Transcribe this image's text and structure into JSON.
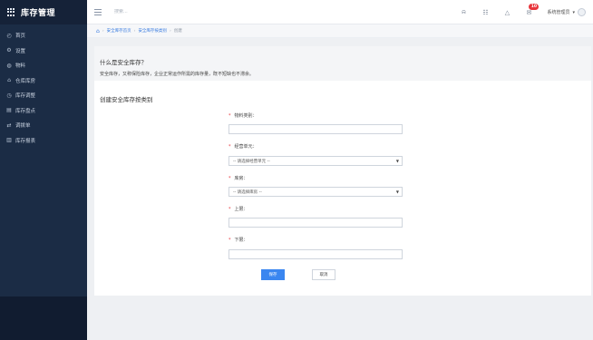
{
  "app": {
    "title": "库存管理"
  },
  "sidebar": {
    "items": [
      {
        "label": "首页",
        "icon": "dashboard-icon"
      },
      {
        "label": "设置",
        "icon": "settings-icon"
      },
      {
        "label": "物料",
        "icon": "material-icon"
      },
      {
        "label": "仓库库房",
        "icon": "warehouse-icon"
      },
      {
        "label": "库存调整",
        "icon": "adjust-icon"
      },
      {
        "label": "库存盘点",
        "icon": "inventory-check-icon"
      },
      {
        "label": "调拨单",
        "icon": "transfer-icon"
      },
      {
        "label": "库存报表",
        "icon": "report-icon"
      }
    ]
  },
  "topbar": {
    "search_placeholder": "搜索...",
    "notification_count": "10",
    "user_name": "系统管理员"
  },
  "breadcrumb": {
    "items": [
      "安全库存首页",
      "安全库存按类别",
      "创建"
    ]
  },
  "info": {
    "title": "什么是安全库存？",
    "description": "安全库存，又称保险库存，企业正常运作所需的库存量，既不短缺也不滞余。"
  },
  "form": {
    "title": "创建安全库存按类别",
    "material_category_label": "物料类别：",
    "material_category_value": "",
    "business_unit_label": "经营单元：",
    "business_unit_value": "-- 请选择经营单元 --",
    "warehouse_label": "库房：",
    "warehouse_value": "-- 请选择库房 --",
    "upper_limit_label": "上限：",
    "upper_limit_value": "",
    "lower_limit_label": "下限：",
    "lower_limit_value": "",
    "required_mark": "*",
    "save_label": "保存",
    "cancel_label": "取消"
  },
  "colors": {
    "sidebar_bg": "#1b2c45",
    "accent": "#3a86f0",
    "required": "#e8353b",
    "badge": "#e8353b"
  }
}
